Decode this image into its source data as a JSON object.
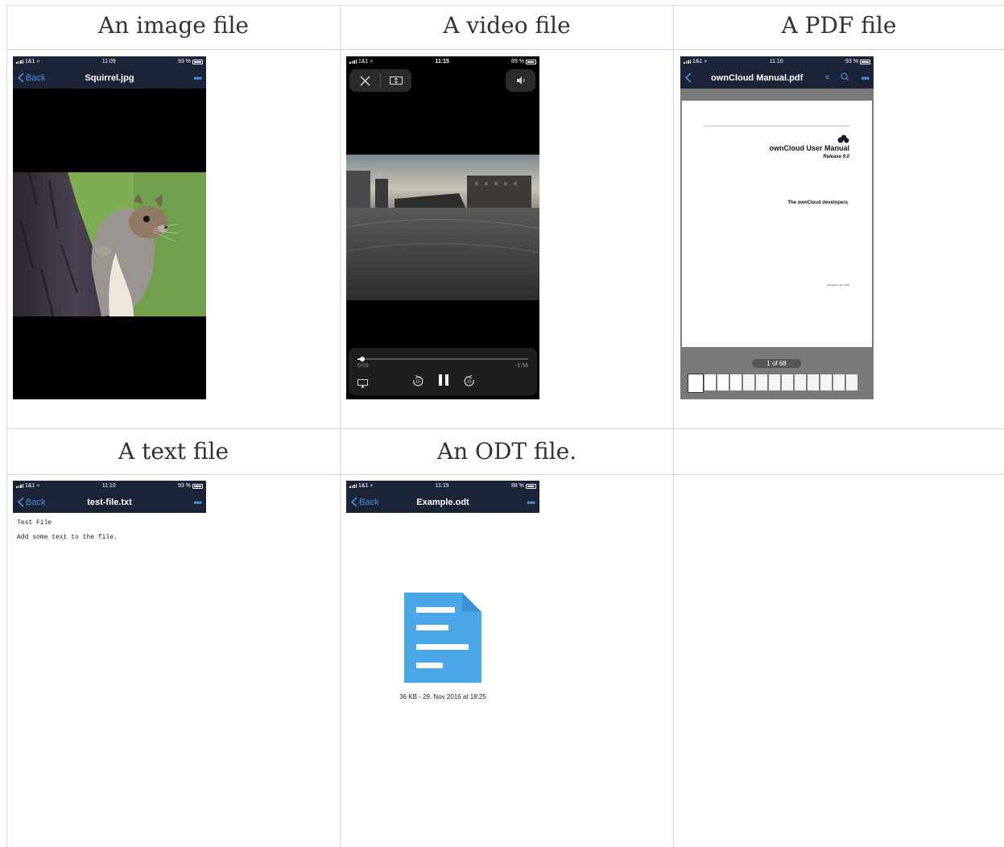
{
  "headers": {
    "image": "An image file",
    "video": "A video file",
    "pdf": "A PDF file",
    "text": "A text file",
    "odt": "An ODT file."
  },
  "image_phone": {
    "carrier": "1&1",
    "time": "11:09",
    "battery": "93 %",
    "back_label": "Back",
    "title": "Squirrel.jpg"
  },
  "video_phone": {
    "carrier": "1&1",
    "time": "11:15",
    "battery": "89 %",
    "elapsed": "0:03",
    "remaining": "-1:56",
    "progress": 0.03,
    "skip_back": "15",
    "skip_forward": "15"
  },
  "pdf_phone": {
    "carrier": "1&1",
    "time": "11:10",
    "battery": "93 %",
    "title": "ownCloud Manual.pdf",
    "doc_title": "ownCloud User Manual",
    "release": "Release 9.0",
    "author": "The ownCloud developers",
    "date": "September 19, 2016",
    "page_indicator": "1 of 68"
  },
  "text_phone": {
    "carrier": "1&1",
    "time": "11:10",
    "battery": "93 %",
    "back_label": "Back",
    "title": "test-file.txt",
    "line1": "Test File",
    "line2": "Add some text to the file."
  },
  "odt_phone": {
    "carrier": "1&1",
    "time": "11:15",
    "battery": "88 %",
    "back_label": "Back",
    "title": "Example.odt",
    "file_info": "36 KB - 29. Nov 2016 at 18:25"
  },
  "colors": {
    "nav_bg": "#1b2437",
    "accent": "#4a90e2",
    "odt_icon": "#4ba8e8"
  },
  "icons": [
    "signal-icon",
    "wifi-icon",
    "battery-icon",
    "chevron-left-icon",
    "more-icon",
    "close-icon",
    "fit-icon",
    "volume-icon",
    "airplay-icon",
    "skip-back-icon",
    "pause-icon",
    "skip-forward-icon",
    "list-icon",
    "search-icon",
    "owncloud-logo-icon",
    "document-icon"
  ]
}
